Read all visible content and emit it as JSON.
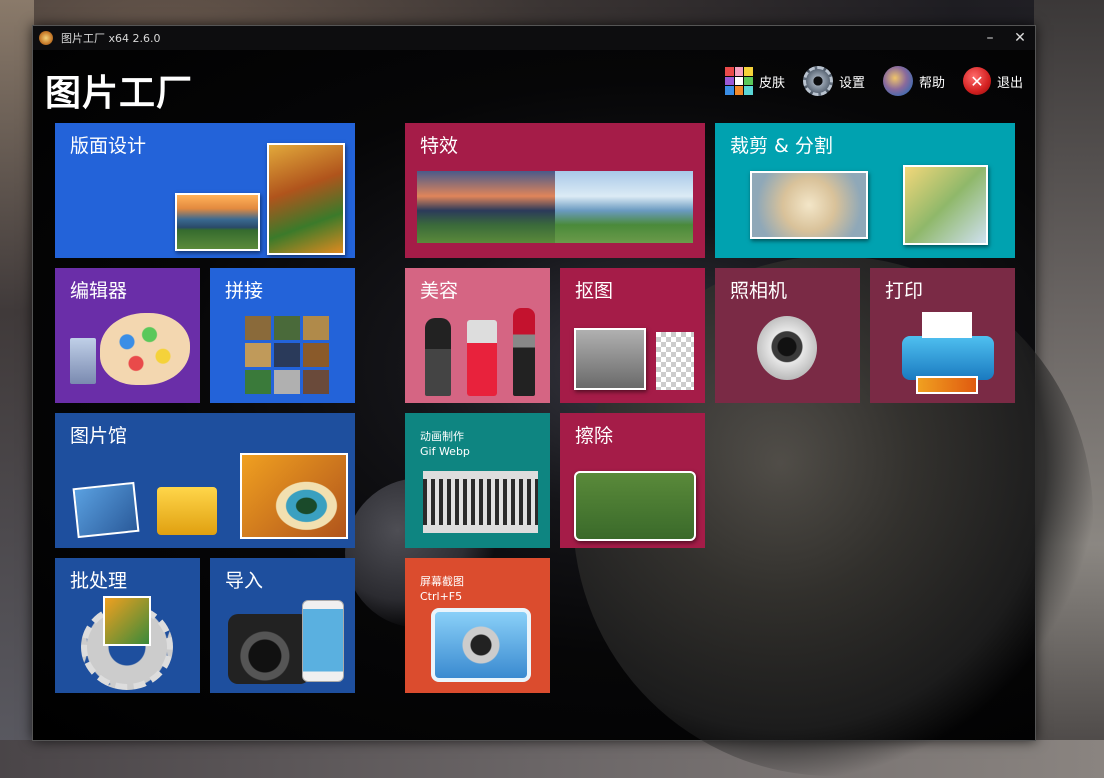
{
  "window": {
    "title": "图片工厂 x64 2.6.0",
    "minimize": "–",
    "close": "✕"
  },
  "app": {
    "title": "图片工厂"
  },
  "nav": {
    "skin": "皮肤",
    "settings": "设置",
    "help": "帮助",
    "exit": "退出",
    "exit_symbol": "✕"
  },
  "tiles": {
    "layout_design": "版面设计",
    "effects": "特效",
    "crop_split": "裁剪 & 分割",
    "editor": "编辑器",
    "stitch": "拼接",
    "beauty": "美容",
    "cutout": "抠图",
    "camera": "照相机",
    "print": "打印",
    "gallery": "图片馆",
    "animation": "动画制作",
    "animation_sub": "Gif Webp",
    "erase": "擦除",
    "batch": "批处理",
    "import": "导入",
    "screenshot": "屏幕截图",
    "screenshot_sub": "Ctrl+F5"
  },
  "colors": {
    "blue": "#2363d9",
    "dark_blue": "#1e4f9e",
    "purple": "#6a2ea8",
    "crimson": "#a51c48",
    "pink": "#d56583",
    "teal": "#00a2b0",
    "maroon": "#7a2a45",
    "green_teal": "#0e8581",
    "orange": "#db4c2e"
  }
}
